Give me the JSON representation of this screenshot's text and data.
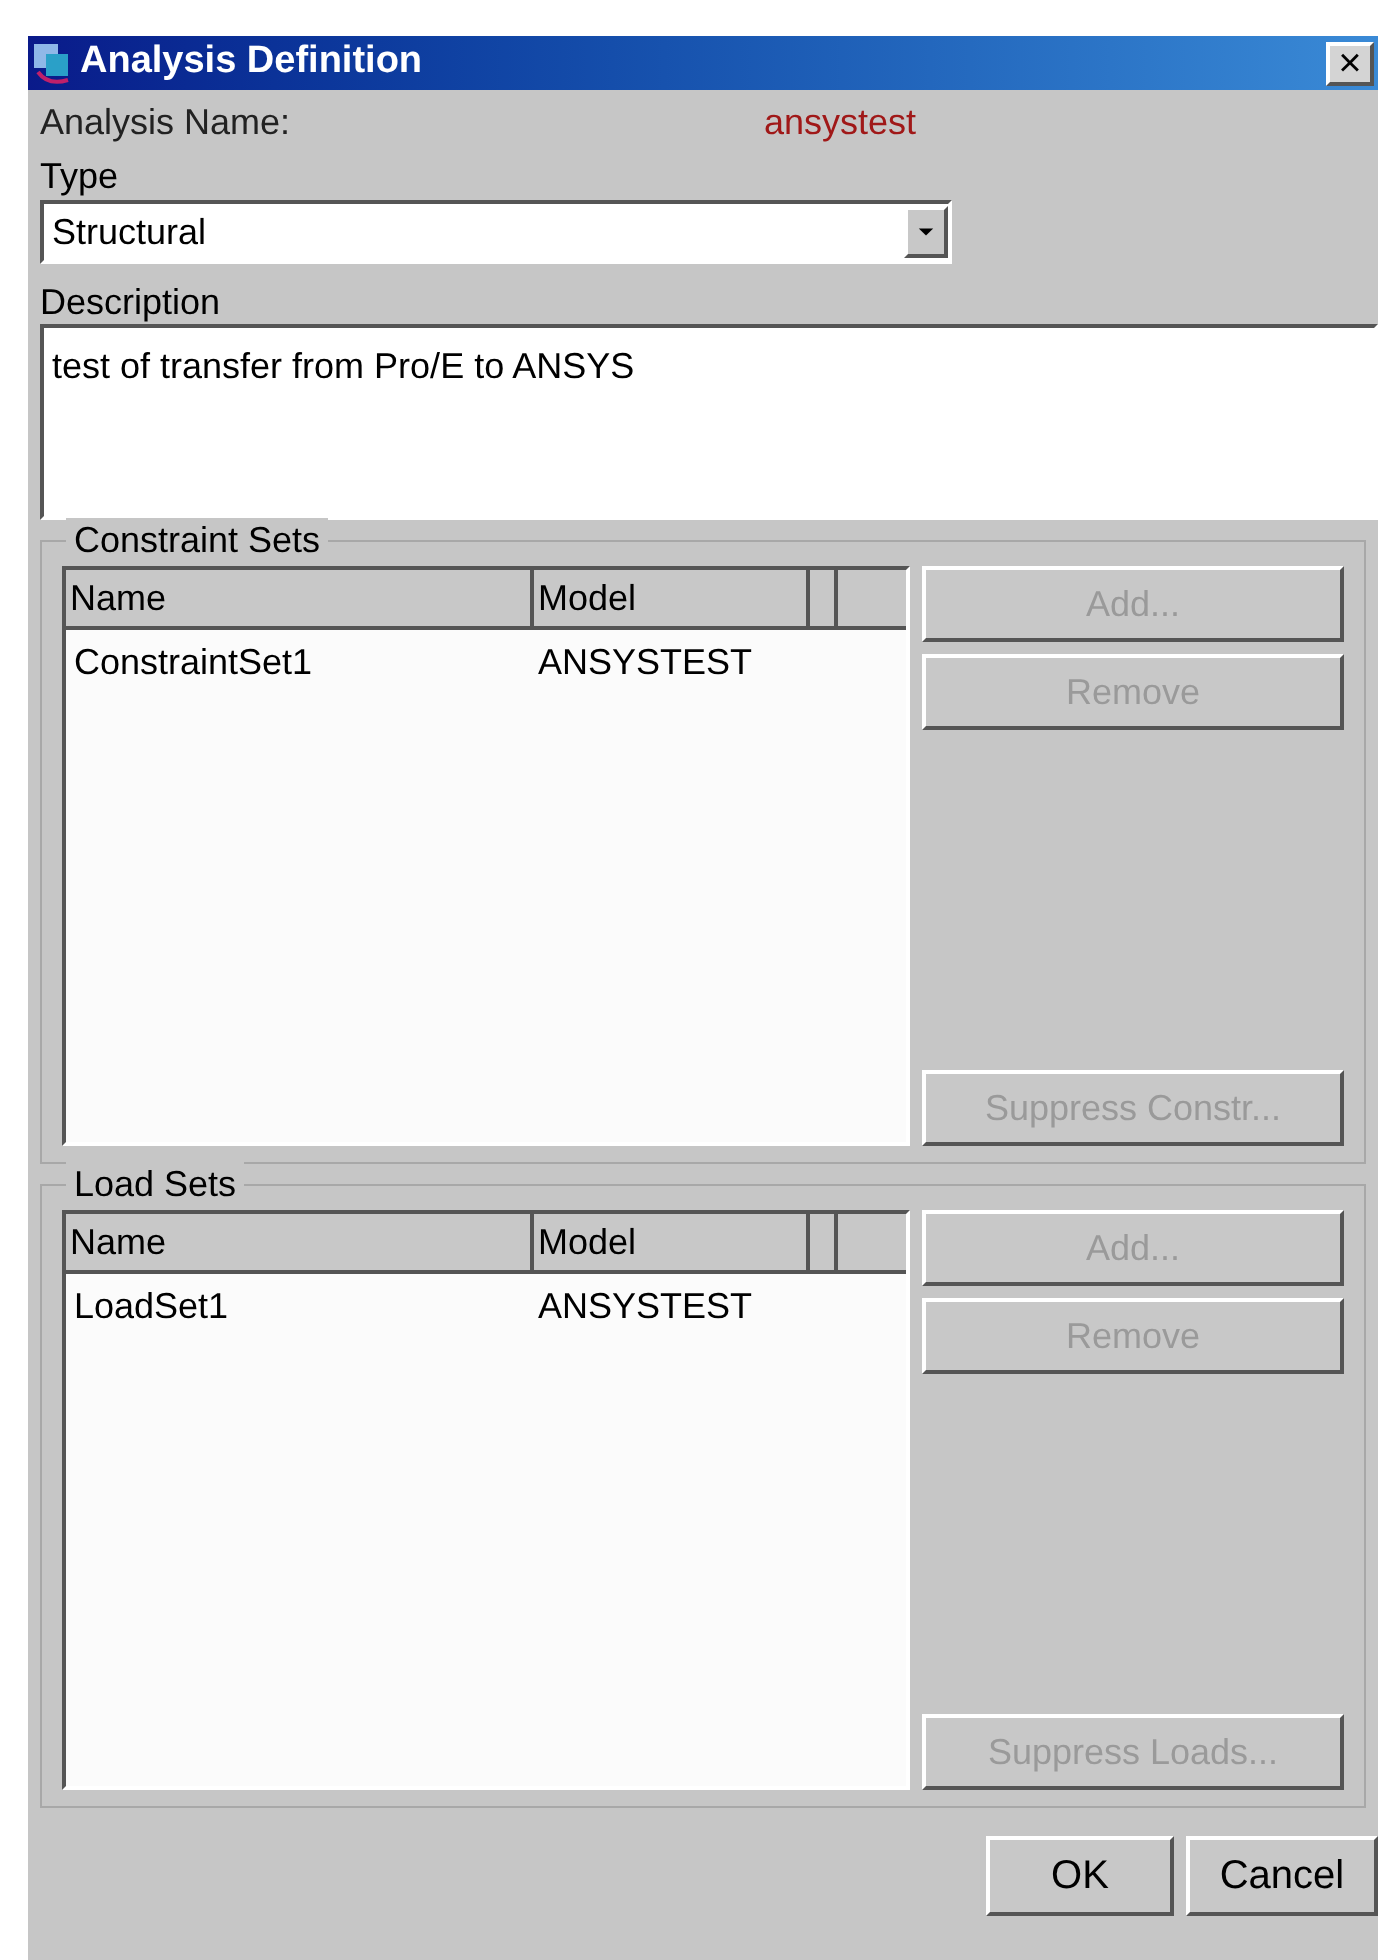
{
  "window": {
    "title": "Analysis Definition",
    "close": "×"
  },
  "analysis_name": {
    "label": "Analysis Name:",
    "value": "ansystest"
  },
  "type": {
    "label": "Type",
    "value": "Structural"
  },
  "description": {
    "label": "Description",
    "value": "test of transfer from Pro/E to ANSYS"
  },
  "groups": [
    {
      "legend": "Constraint Sets",
      "columns": [
        "Name",
        "Model"
      ],
      "rows": [
        [
          "ConstraintSet1",
          "ANSYSTEST"
        ]
      ],
      "buttons": [
        {
          "label": "Add...",
          "disabled": true
        },
        {
          "label": "Remove",
          "disabled": true
        },
        {
          "label": "Suppress Constr...",
          "disabled": true
        }
      ]
    },
    {
      "legend": "Load Sets",
      "columns": [
        "Name",
        "Model"
      ],
      "rows": [
        [
          "LoadSet1",
          "ANSYSTEST"
        ]
      ],
      "buttons": [
        {
          "label": "Add...",
          "disabled": true
        },
        {
          "label": "Remove",
          "disabled": true
        },
        {
          "label": "Suppress Loads...",
          "disabled": true
        }
      ]
    }
  ],
  "footer_buttons": [
    {
      "label": "OK",
      "disabled": false
    },
    {
      "label": "Cancel",
      "disabled": false
    }
  ]
}
